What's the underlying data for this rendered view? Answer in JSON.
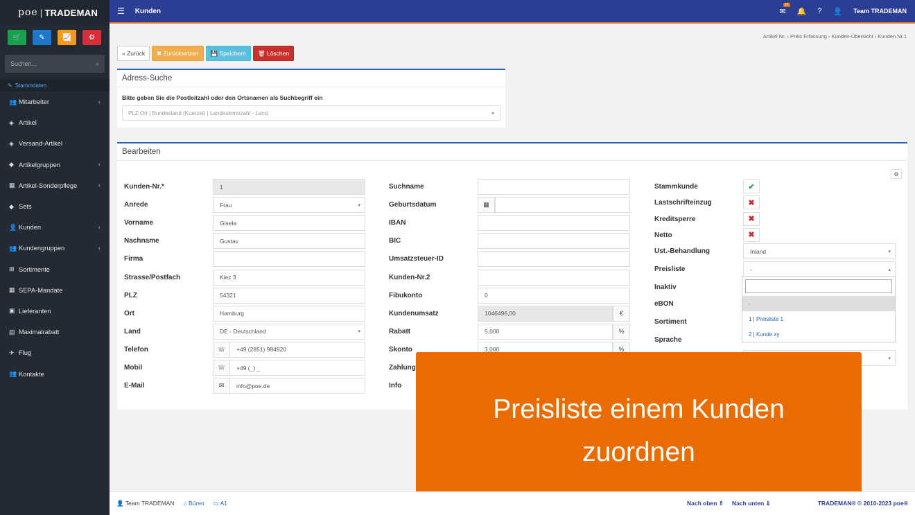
{
  "brand": {
    "poe": "poe",
    "name": "TRADEMAN"
  },
  "sidebar": {
    "search_placeholder": "Suchen...",
    "active": "Stammdaten",
    "items": [
      {
        "label": "Mitarbeiter",
        "icon": "users-icon",
        "sub": true
      },
      {
        "label": "Artikel",
        "icon": "cube-icon",
        "sub": false
      },
      {
        "label": "Versand-Artikel",
        "icon": "cube-icon",
        "sub": false
      },
      {
        "label": "Artikelgruppen",
        "icon": "cubes-icon",
        "sub": true
      },
      {
        "label": "Artikel-Sonderpflege",
        "icon": "table-icon",
        "sub": true
      },
      {
        "label": "Sets",
        "icon": "cubes-icon",
        "sub": false
      },
      {
        "label": "Kunden",
        "icon": "user-icon",
        "sub": true
      },
      {
        "label": "Kundengruppen",
        "icon": "users-icon",
        "sub": true
      },
      {
        "label": "Sortimente",
        "icon": "sitemap-icon",
        "sub": false
      },
      {
        "label": "SEPA-Mandate",
        "icon": "table-icon",
        "sub": false
      },
      {
        "label": "Lieferanten",
        "icon": "truck-icon",
        "sub": false
      },
      {
        "label": "Maximalrabatt",
        "icon": "money-icon",
        "sub": false
      },
      {
        "label": "Flug",
        "icon": "plane-icon",
        "sub": false
      },
      {
        "label": "Kontakte",
        "icon": "contacts-icon",
        "sub": false
      }
    ]
  },
  "header": {
    "title": "Kunden",
    "mail_badge": "16",
    "user": "Team TRADEMAN"
  },
  "breadcrumb": [
    "Artikel Nr.",
    "Preis Erfassung",
    "Kunden-Übersicht",
    "Kunden Nr.1"
  ],
  "actions": {
    "back": "« Zurück",
    "reset": "✖ Zurücksetzen",
    "save": "💾 Speichern",
    "delete": "🗑 Löschen"
  },
  "address": {
    "title": "Adress-Suche",
    "label": "Bitte geben Sie die Postleitzahl oder den Ortsnamen als Suchbegriff ein",
    "placeholder": "PLZ Ort | Bundesland (Kuerzel) | Landeskennzahl - Land"
  },
  "edit": {
    "title": "Bearbeiten",
    "col1": [
      {
        "label": "Kunden-Nr.*",
        "value": "1"
      },
      {
        "label": "Anrede",
        "value": "Frau"
      },
      {
        "label": "Vorname",
        "value": "Gisela"
      },
      {
        "label": "Nachname",
        "value": "Gustav"
      },
      {
        "label": "Firma",
        "value": ""
      },
      {
        "label": "Strasse/Postfach",
        "value": "Kiez 3"
      },
      {
        "label": "PLZ",
        "value": "54321"
      },
      {
        "label": "Ort",
        "value": "Hamburg"
      },
      {
        "label": "Land",
        "value": "DE - Deutschland"
      },
      {
        "label": "Telefon",
        "value": "+49 (2851) 984920"
      },
      {
        "label": "Mobil",
        "value": "+49 (_) _"
      },
      {
        "label": "E-Mail",
        "value": "info@poe.de"
      }
    ],
    "col2": [
      {
        "label": "Suchname",
        "value": ""
      },
      {
        "label": "Geburtsdatum",
        "value": ""
      },
      {
        "label": "IBAN",
        "value": ""
      },
      {
        "label": "BIC",
        "value": ""
      },
      {
        "label": "Umsatzsteuer-ID",
        "value": ""
      },
      {
        "label": "Kunden-Nr.2",
        "value": ""
      },
      {
        "label": "Fibukonto",
        "value": "0"
      },
      {
        "label": "Kundenumsatz",
        "value": "1046496,00",
        "unit": "€"
      },
      {
        "label": "Rabatt",
        "value": "5,000",
        "unit": "%"
      },
      {
        "label": "Skonto",
        "value": "3,000",
        "unit": "%"
      },
      {
        "label": "Zahlungs",
        "value": ""
      },
      {
        "label": "Info",
        "value": ""
      }
    ],
    "col3": [
      {
        "label": "Stammkunde",
        "state": true
      },
      {
        "label": "Lastschrifteinzug",
        "state": false
      },
      {
        "label": "Kreditsperre",
        "state": false
      },
      {
        "label": "Netto",
        "state": false
      }
    ],
    "ust_label": "Ust.-Behandlung",
    "ust_value": "Inland",
    "preis_label": "Preisliste",
    "preis_value": "-",
    "more": [
      "Inaktiv",
      "eBON",
      "Sortiment",
      "Sprache"
    ],
    "dropdown": [
      "-",
      "1 | Preisliste 1",
      "2 | Kunde xy"
    ]
  },
  "overlay": "Preisliste einem Kunden zuordnen",
  "footer": {
    "user": "Team TRADEMAN",
    "office": "Büren",
    "desk": "A1",
    "top": "Nach oben ⇑",
    "bottom": "Nach unten ⇓",
    "copy": "TRADEMAN® © 2010-2023 poe®"
  }
}
